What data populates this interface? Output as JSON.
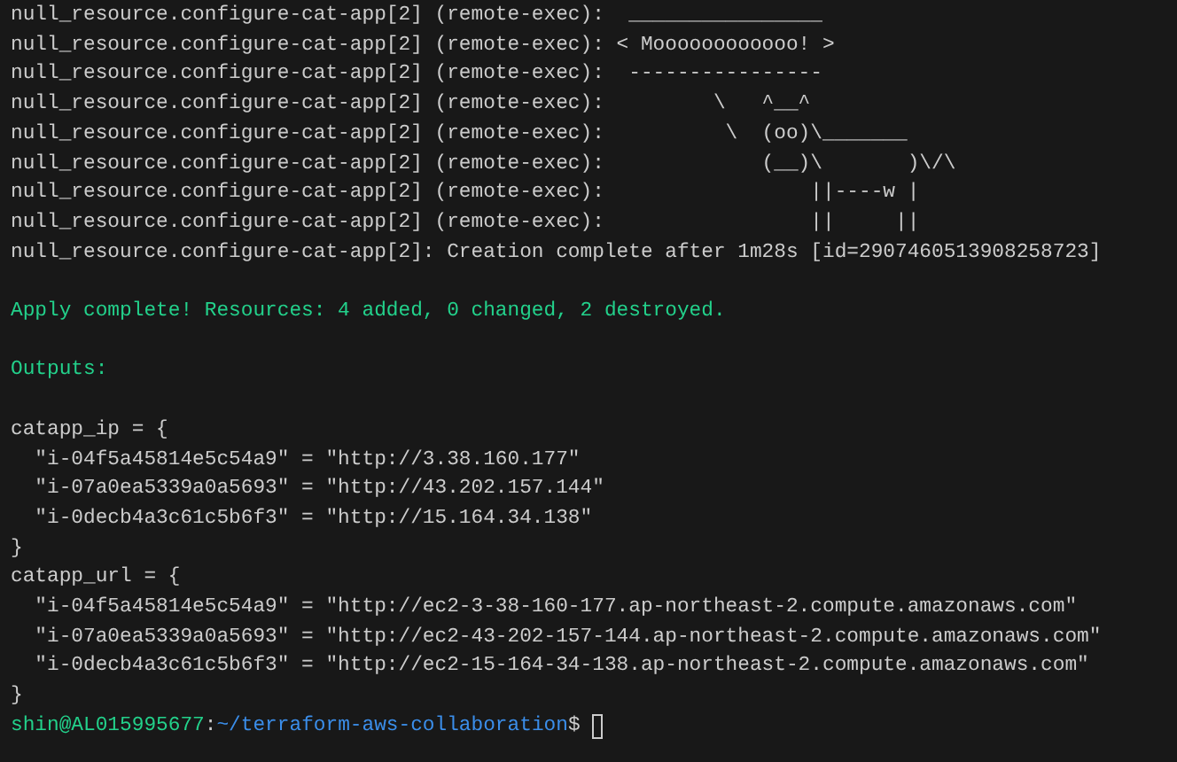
{
  "terminal": {
    "lines": [
      {
        "kind": "plain",
        "text": "null_resource.configure-cat-app[2] (remote-exec):  ________________"
      },
      {
        "kind": "plain",
        "text": "null_resource.configure-cat-app[2] (remote-exec): < Moooooooooooo! >"
      },
      {
        "kind": "plain",
        "text": "null_resource.configure-cat-app[2] (remote-exec):  ----------------"
      },
      {
        "kind": "plain",
        "text": "null_resource.configure-cat-app[2] (remote-exec):         \\   ^__^"
      },
      {
        "kind": "plain",
        "text": "null_resource.configure-cat-app[2] (remote-exec):          \\  (oo)\\_______"
      },
      {
        "kind": "plain",
        "text": "null_resource.configure-cat-app[2] (remote-exec):             (__)\\       )\\/\\"
      },
      {
        "kind": "plain",
        "text": "null_resource.configure-cat-app[2] (remote-exec):                 ||----w |"
      },
      {
        "kind": "plain",
        "text": "null_resource.configure-cat-app[2] (remote-exec):                 ||     ||"
      },
      {
        "kind": "plain",
        "text": "null_resource.configure-cat-app[2]: Creation complete after 1m28s [id=2907460513908258723]"
      },
      {
        "kind": "blank"
      },
      {
        "kind": "success",
        "text": "Apply complete! Resources: 4 added, 0 changed, 2 destroyed."
      },
      {
        "kind": "blank"
      },
      {
        "kind": "success",
        "text": "Outputs:"
      },
      {
        "kind": "blank"
      },
      {
        "kind": "plain",
        "text": "catapp_ip = {"
      },
      {
        "kind": "plain",
        "text": "  \"i-04f5a45814e5c54a9\" = \"http://3.38.160.177\""
      },
      {
        "kind": "plain",
        "text": "  \"i-07a0ea5339a0a5693\" = \"http://43.202.157.144\""
      },
      {
        "kind": "plain",
        "text": "  \"i-0decb4a3c61c5b6f3\" = \"http://15.164.34.138\""
      },
      {
        "kind": "plain",
        "text": "}"
      },
      {
        "kind": "plain",
        "text": "catapp_url = {"
      },
      {
        "kind": "plain",
        "text": "  \"i-04f5a45814e5c54a9\" = \"http://ec2-3-38-160-177.ap-northeast-2.compute.amazonaws.com\""
      },
      {
        "kind": "plain",
        "text": "  \"i-07a0ea5339a0a5693\" = \"http://ec2-43-202-157-144.ap-northeast-2.compute.amazonaws.com\""
      },
      {
        "kind": "plain",
        "text": "  \"i-0decb4a3c61c5b6f3\" = \"http://ec2-15-164-34-138.ap-northeast-2.compute.amazonaws.com\""
      },
      {
        "kind": "plain",
        "text": "}"
      }
    ],
    "prompt": {
      "user_host": "shin@AL015995677",
      "separator": ":",
      "path": "~/terraform-aws-collaboration",
      "symbol": "$"
    }
  }
}
